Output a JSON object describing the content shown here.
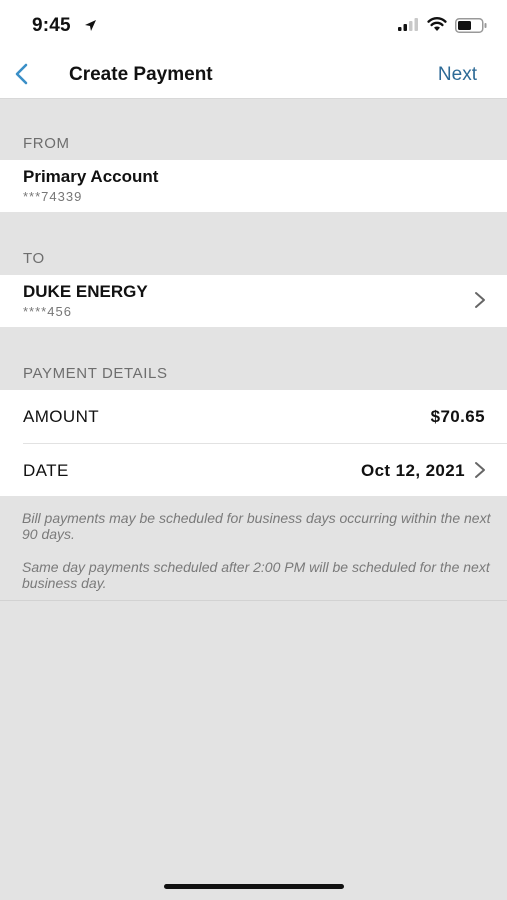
{
  "status": {
    "time": "9:45"
  },
  "nav": {
    "title": "Create Payment",
    "next_label": "Next"
  },
  "from": {
    "header": "FROM",
    "account_name": "Primary Account",
    "account_mask": "***74339"
  },
  "to": {
    "header": "TO",
    "payee_name": "DUKE ENERGY",
    "payee_mask": "****456"
  },
  "details": {
    "header": "PAYMENT DETAILS",
    "amount_label": "AMOUNT",
    "amount_value": "$70.65",
    "date_label": "DATE",
    "date_value": "Oct 12, 2021"
  },
  "notes": {
    "line1": "Bill payments may be scheduled for business days occurring within the next 90 days.",
    "line2": "Same day payments scheduled after 2:00 PM will be scheduled for the next business day."
  },
  "colors": {
    "accent": "#2d6a96",
    "back_arrow": "#3a8fc7",
    "background": "#e3e3e3"
  },
  "icons": [
    "location-arrow-icon",
    "cellular-signal-icon",
    "wifi-icon",
    "battery-icon",
    "back-chevron-icon",
    "chevron-right-icon"
  ]
}
